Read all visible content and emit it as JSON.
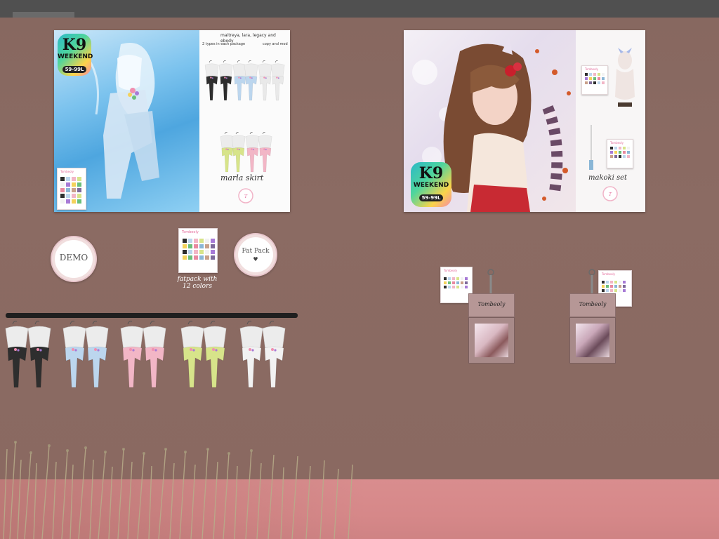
{
  "colors": {
    "wall": "#8a6a62",
    "floor": "#d98d8e",
    "rack": "#1f1f1f",
    "accent_pink": "#e46a9a"
  },
  "poster_left": {
    "badge": {
      "big": "K9",
      "mid": "WEEKEND",
      "pill": "59-99L"
    },
    "body_list": "maitreya, lara, legacy and ebody",
    "types_note": "2 types in each package",
    "perm_note": "copy and mod",
    "title": "marla skirt",
    "swatch_header": "Tombeoly"
  },
  "poster_right": {
    "badge": {
      "big": "K9",
      "mid": "WEEKEND",
      "pill": "59-99L"
    },
    "title": "makoki set",
    "swatch_header": "Tombeoly"
  },
  "demo_seal": {
    "label": "DEMO"
  },
  "fatpack_seal": {
    "label": "Fat Pack",
    "icon": "heart-icon"
  },
  "fatpack_card": {
    "header": "Tombeoly",
    "caption": "fatpack with 12 colors"
  },
  "vendors": [
    {
      "logo": "Tombeoly",
      "swatch_header": "Tombeoly"
    },
    {
      "logo": "Tombeoly",
      "swatch_header": "Tombeoly"
    }
  ],
  "skirt_colors": [
    "#2e2e2e",
    "#bcd6ee",
    "#f2b6c6",
    "#d7e48a",
    "#f2f2f2"
  ],
  "poster_left_colors": [
    "#2e2e2e",
    "#bcd6ee",
    "#e9e9e9",
    "#d7e48a",
    "#f2b6c6"
  ]
}
